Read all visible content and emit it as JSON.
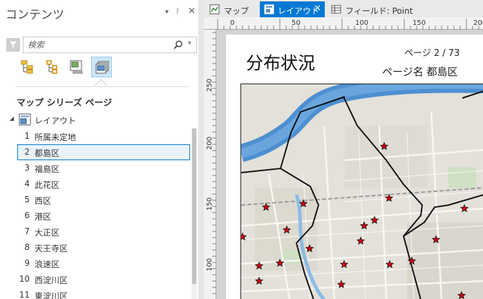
{
  "contents_pane": {
    "title": "コンテンツ",
    "controls": {
      "menu": "▾",
      "pin": "ᚹ",
      "close": "✕"
    },
    "search": {
      "placeholder": "検索",
      "value": ""
    },
    "view_buttons": [
      {
        "icon": "draw-order-icon"
      },
      {
        "icon": "tree-hierarchy-icon"
      },
      {
        "icon": "map-frames-icon"
      },
      {
        "icon": "map-series-pages-icon",
        "active": true
      }
    ],
    "section_heading": "マップ シリーズ ページ",
    "tree_root": {
      "label": "レイアウト"
    },
    "pages": [
      {
        "num": "1",
        "name": "所属未定地"
      },
      {
        "num": "2",
        "name": "都島区",
        "selected": true
      },
      {
        "num": "3",
        "name": "福島区"
      },
      {
        "num": "4",
        "name": "此花区"
      },
      {
        "num": "5",
        "name": "西区"
      },
      {
        "num": "6",
        "name": "港区"
      },
      {
        "num": "7",
        "name": "大正区"
      },
      {
        "num": "8",
        "name": "天王寺区"
      },
      {
        "num": "9",
        "name": "浪速区"
      },
      {
        "num": "10",
        "name": "西淀川区"
      },
      {
        "num": "11",
        "name": "東淀川区"
      }
    ]
  },
  "tabs": [
    {
      "label": "マップ"
    },
    {
      "label": "レイアウト",
      "active": true,
      "close": "✕"
    },
    {
      "label": "フィールド:  Point"
    }
  ],
  "ruler": {
    "horizontal": [
      "0",
      "50",
      "100",
      "150",
      "200"
    ],
    "vertical": [
      "250",
      "200",
      "150",
      "100"
    ]
  },
  "layout": {
    "title": "分布状況",
    "page_number": "ページ 2 / 73",
    "page_name": "ページ名 都島区"
  },
  "colors": {
    "accent": "#0078d4",
    "selection_bg": "#eaf3fb",
    "star_fill": "#d4000f",
    "river": "#4d8fd1"
  }
}
